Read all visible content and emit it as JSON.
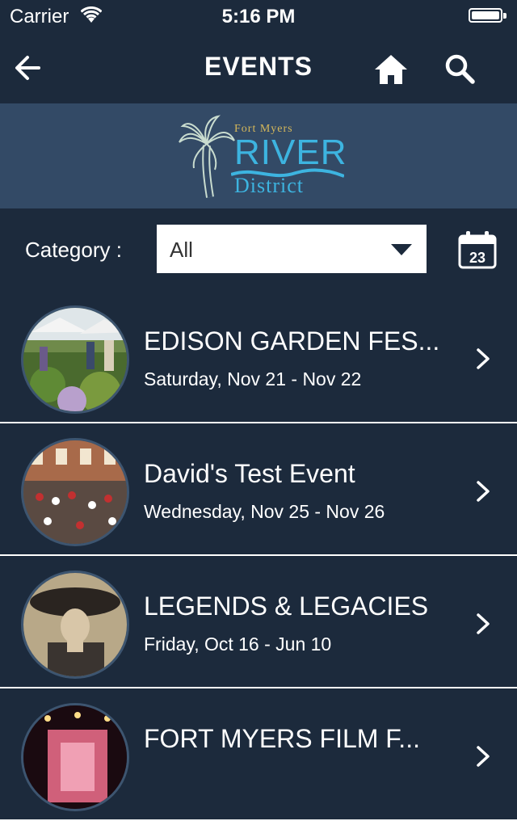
{
  "status": {
    "carrier": "Carrier",
    "time": "5:16 PM"
  },
  "nav": {
    "title": "EVENTS",
    "back_icon": "arrow-left-icon",
    "home_icon": "home-icon",
    "search_icon": "search-icon"
  },
  "banner": {
    "logo_line1": "Fort Myers",
    "logo_line2": "RIVER",
    "logo_line3": "District"
  },
  "filter": {
    "label": "Category :",
    "selected": "All",
    "calendar_day": "23"
  },
  "events": [
    {
      "title": "EDISON GARDEN FES...",
      "date": "Saturday, Nov 21 - Nov 22"
    },
    {
      "title": "David's Test Event",
      "date": "Wednesday, Nov 25 - Nov 26"
    },
    {
      "title": "LEGENDS & LEGACIES",
      "date": "Friday, Oct 16 - Jun 10"
    },
    {
      "title": "FORT MYERS FILM F...",
      "date": ""
    }
  ],
  "colors": {
    "background": "#1c2a3c",
    "banner": "#334a66",
    "accent": "#3db4e0"
  }
}
